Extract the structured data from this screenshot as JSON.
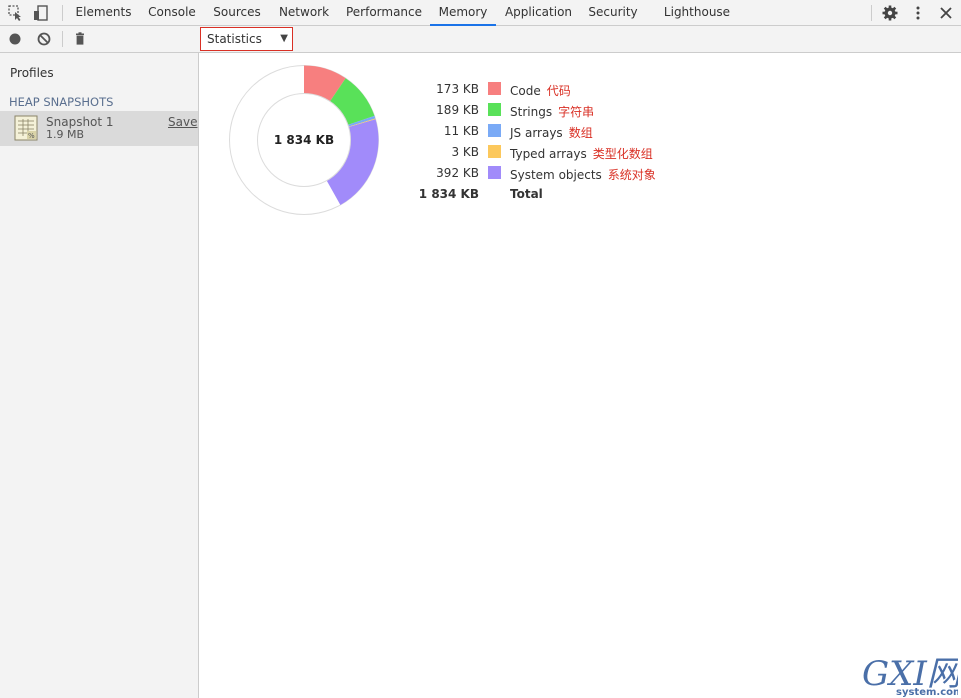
{
  "topbar": {
    "tabs": [
      {
        "label": "Elements",
        "active": false
      },
      {
        "label": "Console",
        "active": false
      },
      {
        "label": "Sources",
        "active": false
      },
      {
        "label": "Network",
        "active": false
      },
      {
        "label": "Performance",
        "active": false
      },
      {
        "label": "Memory",
        "active": true
      },
      {
        "label": "Application",
        "active": false
      },
      {
        "label": "Security",
        "active": false
      },
      {
        "label": "Lighthouse",
        "active": false
      }
    ],
    "icons": [
      "inspect-element-icon",
      "device-toggle-icon",
      "gear-icon",
      "more-vertical-icon",
      "close-icon"
    ],
    "accent": "#1a73e8"
  },
  "toolbar2": {
    "icons": [
      "record-icon",
      "clear-icon",
      "trash-icon"
    ],
    "view_select": "Statistics"
  },
  "sidebar": {
    "title": "Profiles",
    "section": "HEAP SNAPSHOTS",
    "snapshot": {
      "name": "Snapshot 1",
      "size": "1.9 MB",
      "save_label": "Save"
    }
  },
  "stats": {
    "center_label": "1 834 KB",
    "rows": [
      {
        "size": "173 KB",
        "label": "Code",
        "note": "代码",
        "color": "#f77f7f",
        "kb": 173
      },
      {
        "size": "189 KB",
        "label": "Strings",
        "note": "字符串",
        "color": "#59e159",
        "kb": 189
      },
      {
        "size": "11 KB",
        "label": "JS arrays",
        "note": "数组",
        "color": "#7aaaf6",
        "kb": 11
      },
      {
        "size": "3 KB",
        "label": "Typed arrays",
        "note": "类型化数组",
        "color": "#fcc85c",
        "kb": 3
      },
      {
        "size": "392 KB",
        "label": "System objects",
        "note": "系统对象",
        "color": "#a18bfa",
        "kb": 392
      }
    ],
    "total": {
      "size": "1 834 KB",
      "label": "Total",
      "kb": 1834
    },
    "note_color": "#d93025"
  },
  "watermark": {
    "big": "GXI网",
    "small": "system.com"
  }
}
